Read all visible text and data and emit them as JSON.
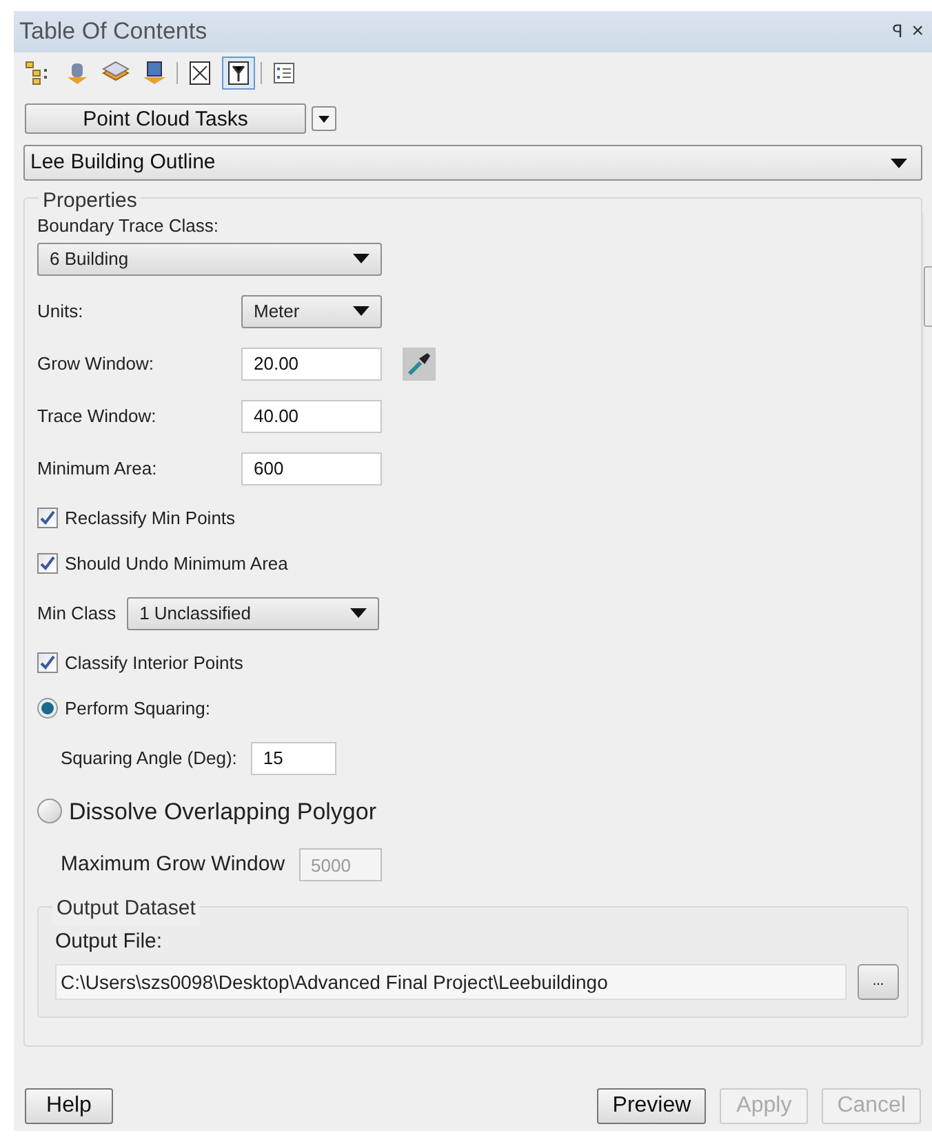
{
  "window": {
    "title": "Table Of Contents",
    "pin": "ꟼ",
    "close": "×"
  },
  "toolbar": [
    {
      "kind": "tree",
      "selected": false
    },
    {
      "kind": "drum",
      "selected": false
    },
    {
      "kind": "layers",
      "selected": false
    },
    {
      "kind": "source",
      "selected": false
    },
    {
      "kind": "sep"
    },
    {
      "kind": "doc",
      "selected": false
    },
    {
      "kind": "doc2",
      "selected": true
    },
    {
      "kind": "sep"
    },
    {
      "kind": "list",
      "selected": false
    }
  ],
  "task_button": "Point Cloud Tasks",
  "task_selector": {
    "value": "Lee Building Outline"
  },
  "properties": {
    "title": "Properties",
    "rows": [
      {
        "kind": "stacked-dropdown",
        "label": "Boundary Trace Class:",
        "value": "6  Building"
      },
      {
        "kind": "dropdown",
        "label": "Units:",
        "value": "Meter"
      },
      {
        "kind": "field",
        "label": "Grow Window:",
        "value": "20.00",
        "picker": true
      },
      {
        "kind": "field",
        "label": "Trace Window:",
        "value": "40.00",
        "picker": false
      },
      {
        "kind": "field",
        "label": "Minimum Area:",
        "value": "600",
        "picker": false
      },
      {
        "kind": "checkbox",
        "label": "Reclassify Min Points",
        "checked": true
      },
      {
        "kind": "checkbox",
        "label": "Should Undo Minimum Area",
        "checked": true
      },
      {
        "kind": "inline-dropdown",
        "label": "Min Class",
        "value": "1  Unclassified"
      },
      {
        "kind": "checkbox",
        "label": "Classify Interior Points",
        "checked": true
      },
      {
        "kind": "radio",
        "label": "Perform Squaring:",
        "selected": true,
        "large": false
      },
      {
        "kind": "sub-field",
        "label": "Squaring Angle (Deg):",
        "value": "15",
        "disabled": false
      },
      {
        "kind": "radio",
        "label": "Dissolve Overlapping Polygor",
        "selected": false,
        "large": true
      },
      {
        "kind": "sub-field",
        "label": "Maximum Grow Window",
        "value": "5000",
        "disabled": true
      }
    ],
    "output": {
      "title": "Output Dataset",
      "label": "Output File:",
      "value": "C:\\Users\\szs0098\\Desktop\\Advanced Final Project\\Leebuildingo",
      "browse": "..."
    }
  },
  "buttons": [
    {
      "label": "Help",
      "disabled": false
    },
    {
      "label": "Preview",
      "disabled": false
    },
    {
      "label": "Apply",
      "disabled": true
    },
    {
      "label": "Cancel",
      "disabled": true
    }
  ]
}
